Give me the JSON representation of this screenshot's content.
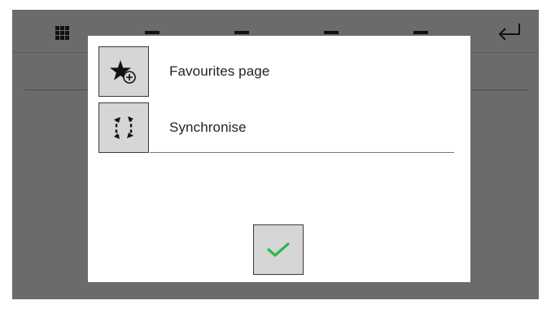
{
  "topbar": {
    "icons": [
      "grid-icon",
      "tab-dash-icon",
      "tab-dash-icon",
      "tab-dash-icon",
      "tab-dash-icon",
      "enter-return-icon"
    ]
  },
  "dialog": {
    "items": [
      {
        "label": "Favourites page",
        "icon": "star-add-icon"
      },
      {
        "label": "Synchronise",
        "icon": "sync-icon"
      }
    ],
    "confirm_icon": "checkmark-icon",
    "confirm_color": "#2db84d"
  },
  "colors": {
    "screen_background": "#6b6b6b",
    "dialog_background": "#ffffff",
    "button_background": "#d6d6d6"
  }
}
